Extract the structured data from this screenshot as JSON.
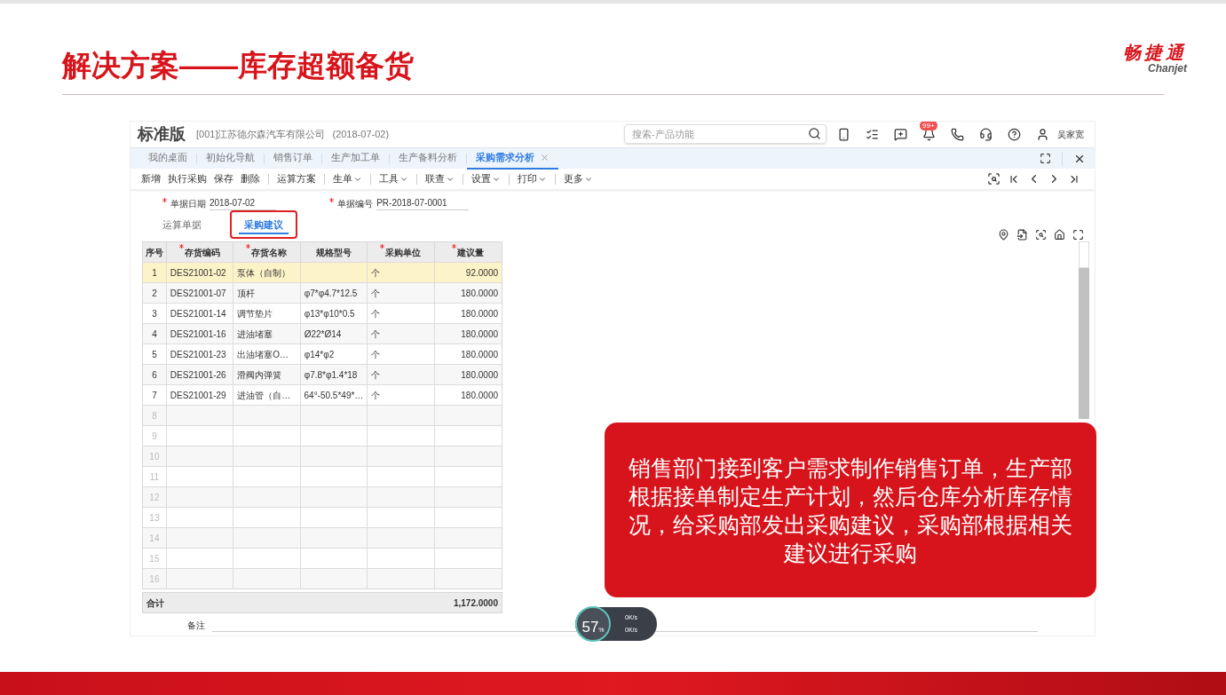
{
  "slide": {
    "title": "解决方案——库存超额备货",
    "logo": {
      "cn": "畅捷通",
      "en": "Chanjet"
    }
  },
  "app": {
    "edition": "标准版",
    "company": "[001]江苏德尔森汽车有限公司",
    "date": "(2018-07-02)",
    "search": {
      "placeholder": "搜索-产品功能"
    },
    "notification_badge": "99+",
    "user": "吴家宽",
    "tabs": [
      {
        "label": "我的桌面",
        "selected": false
      },
      {
        "label": "初始化导航",
        "selected": false
      },
      {
        "label": "销售订单",
        "selected": false
      },
      {
        "label": "生产加工单",
        "selected": false
      },
      {
        "label": "生产备料分析",
        "selected": false
      },
      {
        "label": "采购需求分析",
        "selected": true
      }
    ],
    "toolbar": [
      {
        "label": "新增",
        "dropdown": false
      },
      {
        "label": "执行采购",
        "dropdown": false
      },
      {
        "label": "保存",
        "dropdown": false
      },
      {
        "label": "删除",
        "dropdown": false
      },
      {
        "label": "运算方案",
        "dropdown": false
      },
      {
        "label": "生单",
        "dropdown": true
      },
      {
        "label": "工具",
        "dropdown": true
      },
      {
        "label": "联查",
        "dropdown": true
      },
      {
        "label": "设置",
        "dropdown": true
      },
      {
        "label": "打印",
        "dropdown": true
      },
      {
        "label": "更多",
        "dropdown": true
      }
    ],
    "form": [
      {
        "label": "单据日期",
        "required": true,
        "value": "2018-07-02"
      },
      {
        "label": "单据编号",
        "required": true,
        "value": "PR-2018-07-0001"
      }
    ],
    "subtabs": [
      {
        "label": "运算单据",
        "selected": false,
        "highlighted": false
      },
      {
        "label": "采购建议",
        "selected": true,
        "highlighted": true
      }
    ],
    "table": {
      "columns": [
        {
          "label": "序号",
          "required": false
        },
        {
          "label": "存货编码",
          "required": true
        },
        {
          "label": "存货名称",
          "required": true
        },
        {
          "label": "规格型号",
          "required": false
        },
        {
          "label": "采购单位",
          "required": true
        },
        {
          "label": "建议量",
          "required": true
        }
      ],
      "rows": [
        {
          "cells": [
            "1",
            "DES21001-02",
            "泵体（自制）",
            "",
            "个",
            "92.0000"
          ],
          "selected": true
        },
        {
          "cells": [
            "2",
            "DES21001-07",
            "顶杆",
            "φ7*φ4.7*12.5",
            "个",
            "180.0000"
          ],
          "selected": false
        },
        {
          "cells": [
            "3",
            "DES21001-14",
            "调节垫片",
            "φ13*φ10*0.5",
            "个",
            "180.0000"
          ],
          "selected": false
        },
        {
          "cells": [
            "4",
            "DES21001-16",
            "进油堵塞",
            "Ø22*Ø14",
            "个",
            "180.0000"
          ],
          "selected": false
        },
        {
          "cells": [
            "5",
            "DES21001-23",
            "出油堵塞O…",
            "φ14*φ2",
            "个",
            "180.0000"
          ],
          "selected": false
        },
        {
          "cells": [
            "6",
            "DES21001-26",
            "滑阀内弹簧",
            "φ7.8*φ1.4*18",
            "个",
            "180.0000"
          ],
          "selected": false
        },
        {
          "cells": [
            "7",
            "DES21001-29",
            "进油管（自…",
            "64°-50.5*49*…",
            "个",
            "180.0000"
          ],
          "selected": false
        },
        {
          "cells": [
            "8"
          ],
          "selected": false
        },
        {
          "cells": [
            "9"
          ],
          "selected": false
        },
        {
          "cells": [
            "10"
          ],
          "selected": false
        },
        {
          "cells": [
            "11"
          ],
          "selected": false
        },
        {
          "cells": [
            "12"
          ],
          "selected": false
        },
        {
          "cells": [
            "13"
          ],
          "selected": false
        },
        {
          "cells": [
            "14"
          ],
          "selected": false
        },
        {
          "cells": [
            "15"
          ],
          "selected": false
        },
        {
          "cells": [
            "16"
          ],
          "selected": false
        }
      ],
      "total": {
        "label": "合计",
        "value": "1,172.0000"
      }
    },
    "remark": {
      "label": "备注"
    },
    "network": {
      "percent": "57",
      "unit": "%",
      "up": "0K/s",
      "down": "0K/s"
    }
  },
  "callout": "销售部门接到客户需求制作销售订单，生产部根据接单制定生产计划，然后仓库分析库存情况，给采购部发出采购建议，采购部根据相关建议进行采购"
}
